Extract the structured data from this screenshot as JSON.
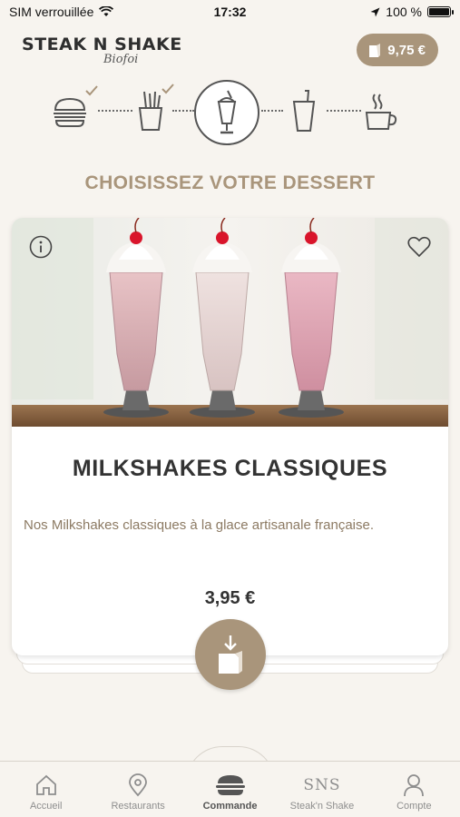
{
  "status_bar": {
    "carrier": "SIM verrouillée",
    "time": "17:32",
    "battery": "100 %",
    "battery_level": 1.0
  },
  "header": {
    "brand": "STEAK N SHAKE",
    "brand_sub": "Biofoi",
    "cart_total": "9,75 €"
  },
  "steps": [
    {
      "icon": "burger-icon",
      "done": true
    },
    {
      "icon": "fries-icon",
      "done": true
    },
    {
      "icon": "milkshake-icon",
      "current": true
    },
    {
      "icon": "drink-icon",
      "done": false
    },
    {
      "icon": "coffee-icon",
      "done": false
    }
  ],
  "section_title": "CHOISISSEZ VOTRE DESSERT",
  "product": {
    "name": "MILKSHAKES CLASSIQUES",
    "description": "Nos Milkshakes classiques à la glace artisanale française.",
    "price": "3,95 €"
  },
  "tabs": [
    {
      "label": "Accueil",
      "icon": "home-icon",
      "active": false
    },
    {
      "label": "Restaurants",
      "icon": "location-icon",
      "active": false
    },
    {
      "label": "Commande",
      "icon": "burger-icon",
      "active": true
    },
    {
      "label": "Steak'n Shake",
      "icon": "sns-icon",
      "icon_text": "SNS",
      "active": false
    },
    {
      "label": "Compte",
      "icon": "user-icon",
      "active": false
    }
  ],
  "colors": {
    "accent": "#a9957b",
    "background": "#f7f4ef",
    "text": "#333333"
  }
}
